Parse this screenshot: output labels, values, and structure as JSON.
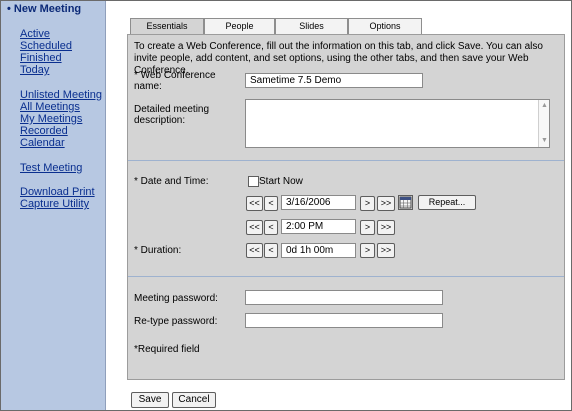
{
  "sidebar": {
    "title": "• New Meeting",
    "links": [
      "Active",
      "Scheduled",
      "Finished",
      "Today",
      "Unlisted Meeting",
      "All Meetings",
      "My Meetings",
      "Recorded",
      "Calendar",
      "Test Meeting",
      "Download Print",
      "Capture Utility"
    ]
  },
  "tabs": [
    "Essentials",
    "People",
    "Slides",
    "Options"
  ],
  "form": {
    "intro": "To create a Web Conference, fill out the information on this tab, and click Save. You can also invite people, add content, and set options, using the other tabs, and then save your Web Conference.",
    "name_label": "* Web Conference name:",
    "name_value": "Sametime 7.5 Demo",
    "desc_label": "Detailed meeting description:",
    "date_label": "* Date and Time:",
    "start_now": "Start Now",
    "date_value": "3/16/2006",
    "time_value": "2:00 PM",
    "repeat_label": "Repeat...",
    "duration_label": "* Duration:",
    "duration_value": "0d 1h 00m",
    "nav_prev_prev": "<<",
    "nav_prev": "<",
    "nav_next": ">",
    "nav_next_next": ">>",
    "password_label": "Meeting password:",
    "retype_label": "Re-type password:",
    "required_note": "*Required field"
  },
  "actions": {
    "save": "Save",
    "cancel": "Cancel"
  },
  "colors": {
    "sidebar_bg": "#b7c8e2",
    "link": "#0a2f8f",
    "panel_bg": "#d4d4d4"
  }
}
